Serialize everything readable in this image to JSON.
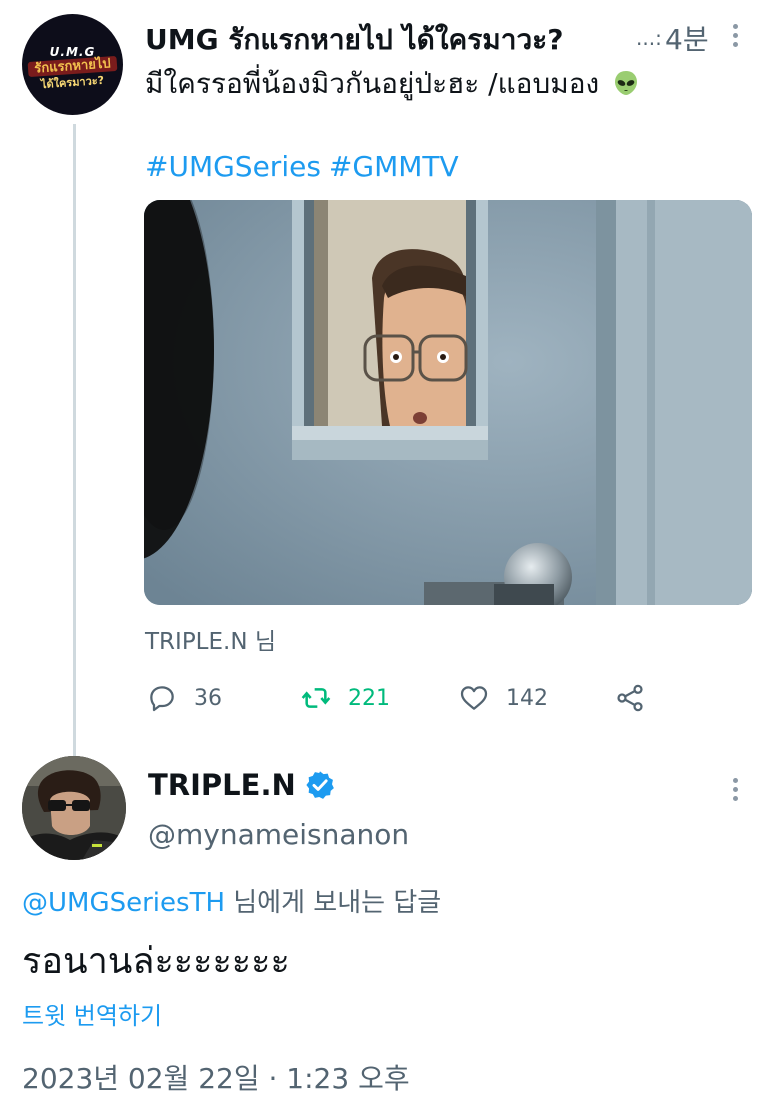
{
  "tweet": {
    "author_name": "UMG รักแรกหายไป ได้ใครมาวะ?",
    "ellipsis": "...:",
    "time": "4분",
    "avatar_logo": {
      "top": "U.M.G",
      "middle": "รักแรกหายไป",
      "bottom": "ได้ใครมาวะ?"
    },
    "text": "มีใครรอพี่น้องมิวกันอยู่ป่ะฮะ /แอบมอง",
    "emoji": "alien-emoji",
    "hashtags": [
      "#UMGSeries",
      "#GMMTV"
    ],
    "media_caption": "TRIPLE.N 님",
    "actions": {
      "replies": "36",
      "retweets": "221",
      "likes": "142"
    }
  },
  "reply": {
    "author_name": "TRIPLE.N",
    "handle": "@mynameisnanon",
    "replying_to_mention": "@UMGSeriesTH",
    "replying_to_suffix": " 님에게 보내는 답글",
    "text": "รอนานล่ะะะะะะะ",
    "translate_label": "트윗 번역하기",
    "timestamp": "2023년 02월 22일 · 1:23 오후"
  },
  "colors": {
    "link": "#1d9bf0",
    "retweet": "#00ba7c",
    "secondary": "#536471",
    "verified": "#1d9bf0"
  }
}
